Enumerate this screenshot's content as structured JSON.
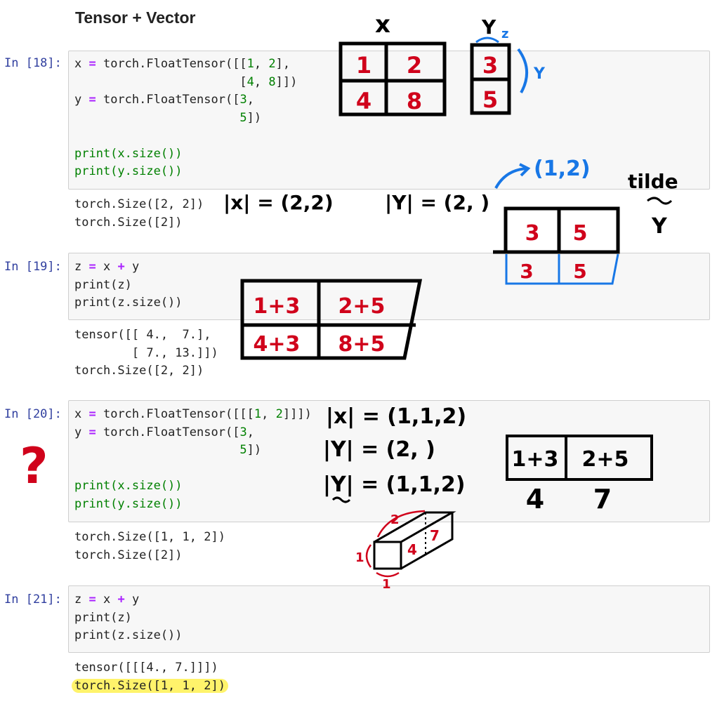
{
  "heading": "Tensor + Vector",
  "cells": [
    {
      "prompt": "In [18]:",
      "code": [
        [
          "x ",
          "=",
          " torch.FloatTensor([[",
          "1",
          ", ",
          "2",
          "],"
        ],
        [
          "                       [",
          "4",
          ", ",
          "8",
          "]])"
        ],
        [
          "y ",
          "=",
          " torch.FloatTensor([",
          "3",
          ","
        ],
        [
          "                       ",
          "5",
          "])"
        ],
        [
          ""
        ],
        [
          "print(x.size())"
        ],
        [
          "print(y.size())"
        ]
      ],
      "output": [
        "torch.Size([2, 2])",
        "torch.Size([2])"
      ]
    },
    {
      "prompt": "In [19]:",
      "code": [
        [
          "z ",
          "=",
          " x ",
          "+",
          " y"
        ],
        [
          "print(z)"
        ],
        [
          "print(z.size())"
        ]
      ],
      "output": [
        "tensor([[ 4.,  7.],",
        "        [ 7., 13.]])",
        "torch.Size([2, 2])"
      ]
    },
    {
      "prompt": "In [20]:",
      "code": [
        [
          "x ",
          "=",
          " torch.FloatTensor([[[",
          "1",
          ", ",
          "2",
          "]]])"
        ],
        [
          "y ",
          "=",
          " torch.FloatTensor([",
          "3",
          ","
        ],
        [
          "                       ",
          "5",
          "])"
        ],
        [
          ""
        ],
        [
          "print(x.size())"
        ],
        [
          "print(y.size())"
        ]
      ],
      "output": [
        "torch.Size([1, 1, 2])",
        "torch.Size([2])"
      ]
    },
    {
      "prompt": "In [21]:",
      "code": [
        [
          "z ",
          "=",
          " x ",
          "+",
          " y"
        ],
        [
          "print(z)"
        ],
        [
          "print(z.size())"
        ]
      ],
      "output": [
        "tensor([[[4., 7.]]])",
        "torch.Size([1, 1, 2])"
      ]
    }
  ],
  "annotations": {
    "x_label": "x",
    "y_label": "Y",
    "z_label": "z",
    "y_dim_label": "Y",
    "x_matrix": [
      "1",
      "2",
      "4",
      "8"
    ],
    "y_vector": [
      "3",
      "5"
    ],
    "x_shape": "|x| = (2,2)",
    "y_shape": "|Y| = (2, )",
    "y_reshaped": "(1,2)",
    "tilde_label": "tilde",
    "tilde_y": "Y",
    "broadcast_row_black": [
      "3",
      "5"
    ],
    "broadcast_row_blue": [
      "3",
      "5"
    ],
    "sum_matrix": [
      "1+3",
      "2+5",
      "4+3",
      "8+5"
    ],
    "question_mark": "?",
    "x3_shape": "|x| = (1,1,2)",
    "y3_shape": "|Y| = (2, )",
    "y3_tilde_shape": "|Y| = (1,1,2)",
    "sum_row": [
      "1+3",
      "2+5"
    ],
    "result_row": [
      "4",
      "7"
    ],
    "box_labels": [
      "2",
      "1",
      "1",
      "4",
      "7"
    ],
    "colors": {
      "ink": "#000000",
      "red": "#d0021b",
      "blue": "#1877e6",
      "highlight": "#fff36b"
    }
  }
}
